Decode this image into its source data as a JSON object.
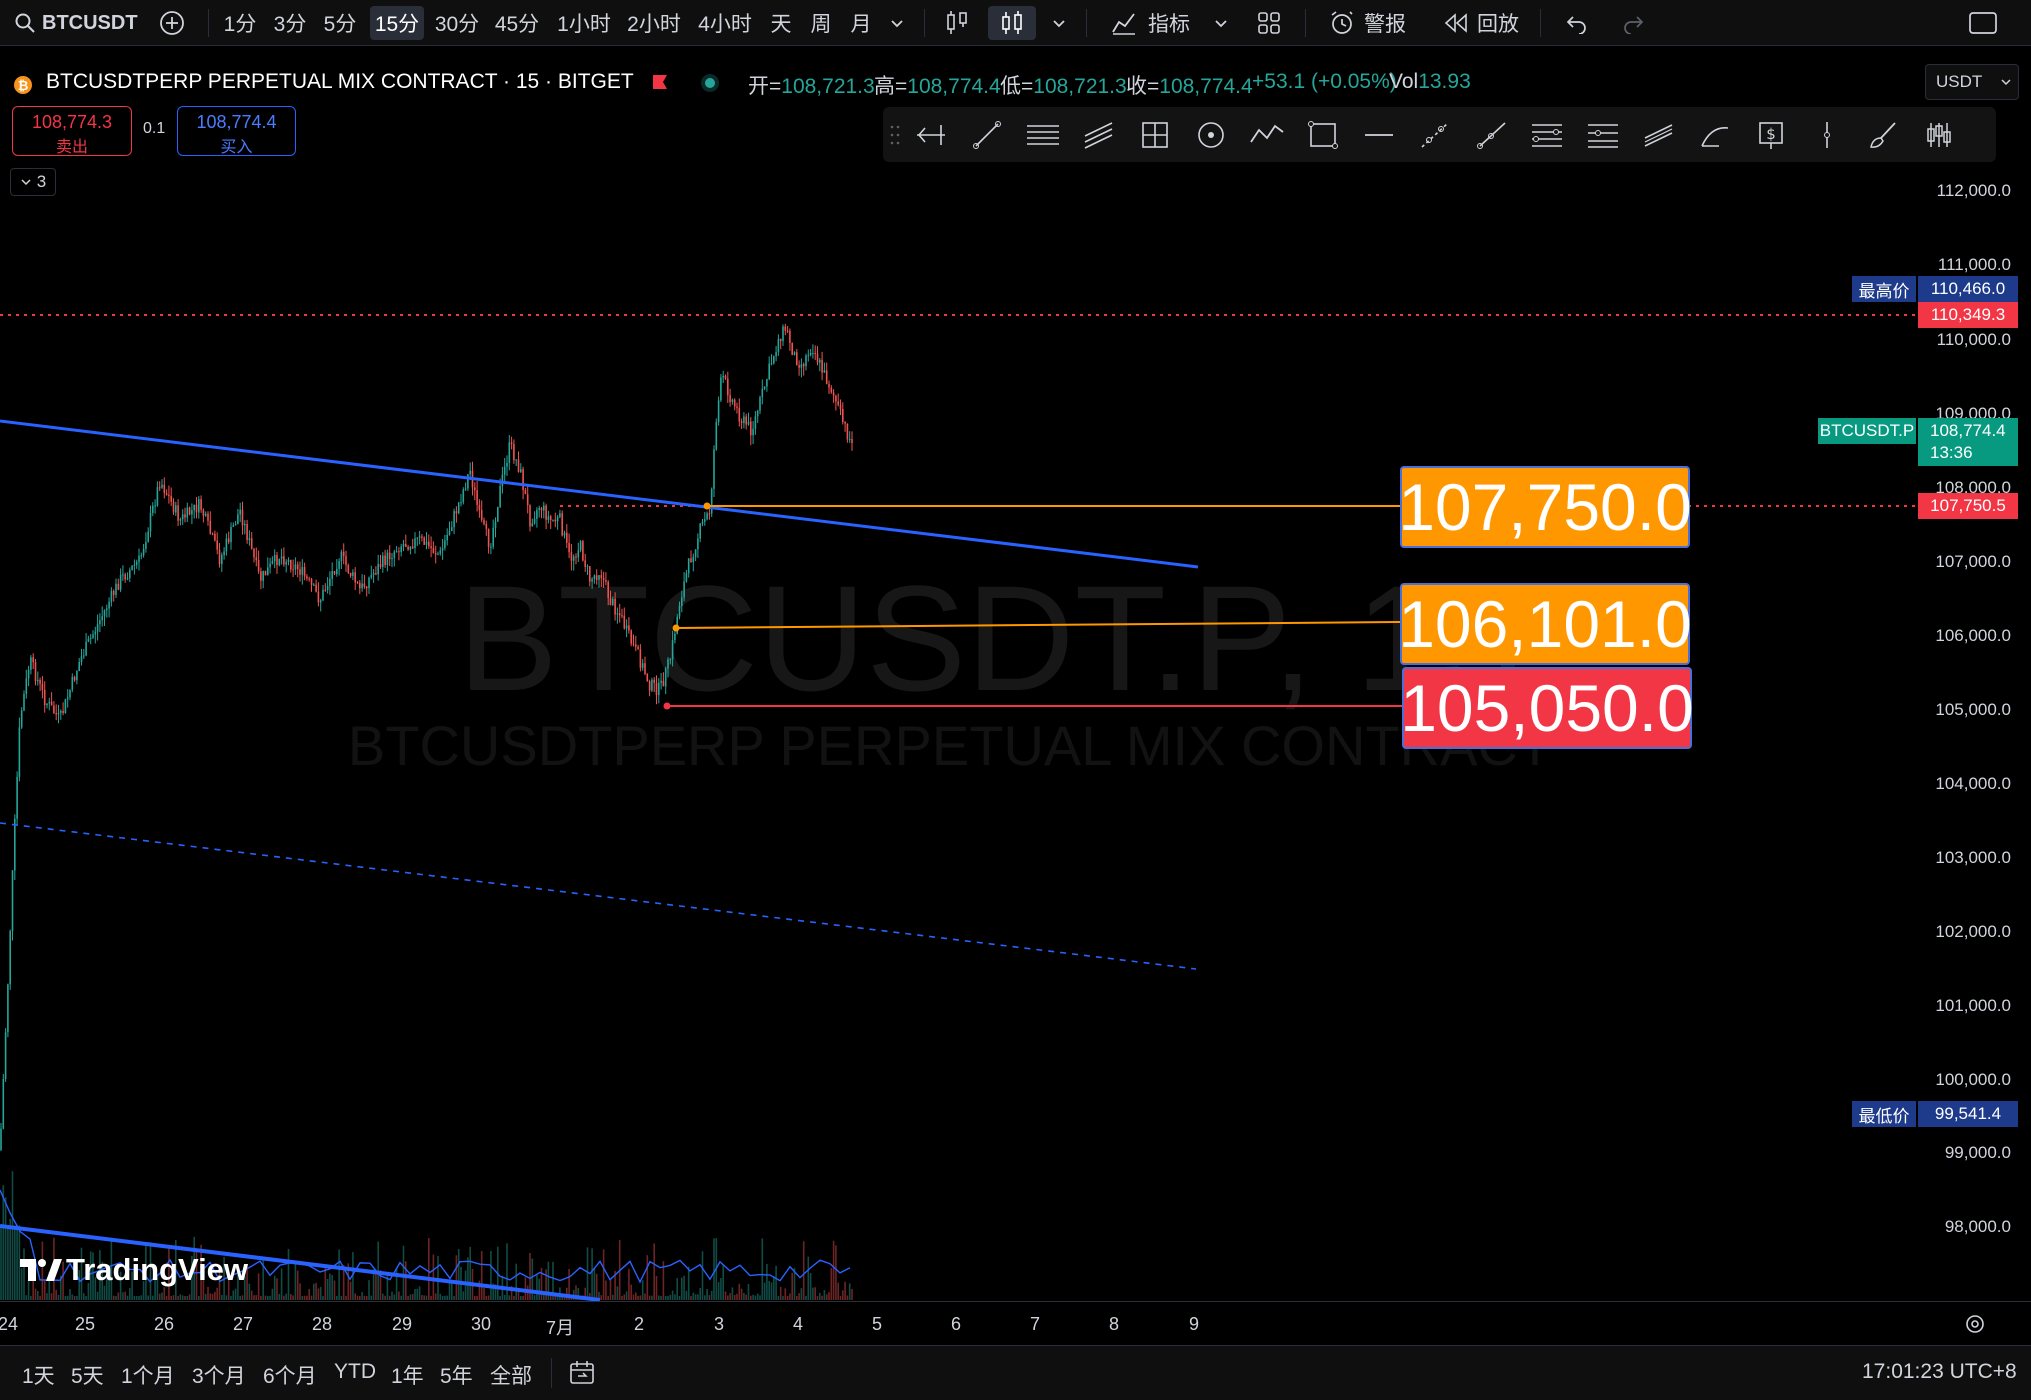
{
  "toolbar": {
    "symbol": "BTCUSDT",
    "intervals": [
      "1分",
      "3分",
      "5分",
      "15分",
      "30分",
      "45分",
      "1小时",
      "2小时",
      "4小时",
      "天",
      "周",
      "月"
    ],
    "active_interval": "15分",
    "indicators_label": "指标",
    "alert_label": "警报",
    "replay_label": "回放"
  },
  "legend": {
    "title": "BTCUSDTPERP PERPETUAL MIX CONTRACT · 15 · BITGET",
    "open_label": "开=",
    "open": "108,721.3",
    "high_label": "高=",
    "high": "108,774.4",
    "low_label": "低=",
    "low": "108,721.3",
    "close_label": "收=",
    "close": "108,774.4",
    "change": "+53.1 (+0.05%)",
    "vol_label": "Vol",
    "vol": "13.93",
    "currency": "USDT"
  },
  "order": {
    "sell_price": "108,774.3",
    "sell_label": "卖出",
    "spread": "0.1",
    "buy_price": "108,774.4",
    "buy_label": "买入",
    "collapse_count": "3"
  },
  "watermark": {
    "symbol": "BTCUSDT.P, 15",
    "name": "BTCUSDTPERP PERPETUAL MIX CONTRACT"
  },
  "logo": "TradingView",
  "price_axis": {
    "ticks": [
      "112,000.0",
      "111,000.0",
      "110,000.0",
      "109,000.0",
      "108,000.0",
      "107,000.0",
      "106,000.0",
      "105,000.0",
      "104,000.0",
      "103,000.0",
      "102,000.0",
      "101,000.0",
      "100,000.0",
      "99,000.0",
      "98,000.0"
    ],
    "high_label": "最高价",
    "high_value": "110,466.0",
    "line_value": "110,349.3",
    "symbol_tag": "BTCUSDT.P",
    "last_price": "108,774.4",
    "countdown": "13:36",
    "alert_value": "107,750.5",
    "low_label": "最低价",
    "low_value": "99,541.4"
  },
  "levels": {
    "level1": "107,750.0",
    "level2": "106,101.0",
    "level3": "105,050.0"
  },
  "time_axis": [
    "24",
    "25",
    "26",
    "27",
    "28",
    "29",
    "30",
    "7月",
    "2",
    "3",
    "4",
    "5",
    "6",
    "7",
    "8",
    "9"
  ],
  "ranges": [
    "1天",
    "5天",
    "1个月",
    "3个月",
    "6个月",
    "YTD",
    "1年",
    "5年",
    "全部"
  ],
  "clock": "17:01:23 UTC+8",
  "colors": {
    "up": "#26a69a",
    "down": "#ef5350",
    "trendline": "#2962ff",
    "orange": "#ff9800",
    "red": "#f23645",
    "background": "#000000"
  }
}
